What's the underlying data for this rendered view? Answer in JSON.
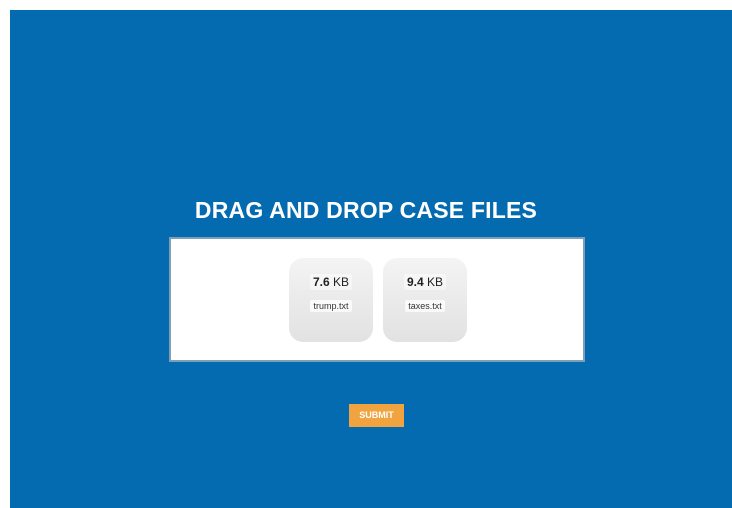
{
  "header": {
    "title": "DRAG AND DROP CASE FILES"
  },
  "dropzone": {
    "files": [
      {
        "size_value": "7.6",
        "size_unit": "KB",
        "filename": "trump.txt"
      },
      {
        "size_value": "9.4",
        "size_unit": "KB",
        "filename": "taxes.txt"
      }
    ]
  },
  "actions": {
    "submit_label": "SUBMIT"
  },
  "colors": {
    "background": "#046bb1",
    "dropzone_bg": "#ffffff",
    "dropzone_border": "#7f9fb9",
    "submit_bg": "#f0a33f",
    "title_text": "#ffffff"
  }
}
